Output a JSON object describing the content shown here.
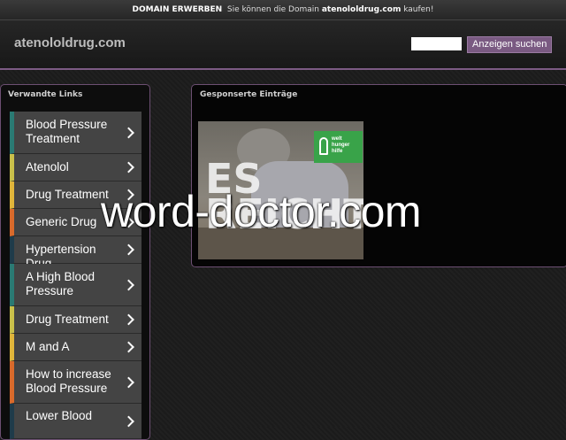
{
  "topbar": {
    "label": "DOMAIN ERWERBEN",
    "text_before": "Sie können die Domain",
    "domain": "atenololdrug.com",
    "text_after": "kaufen!"
  },
  "header": {
    "site_title": "atenololdrug.com",
    "search_placeholder": "",
    "search_button": "Anzeigen suchen"
  },
  "sidebar": {
    "title": "Verwandte Links",
    "items": [
      {
        "label": "Blood Pressure Treatment",
        "accent": "#2a7a73"
      },
      {
        "label": "Atenolol",
        "accent": "#c9c04a"
      },
      {
        "label": "Drug Treatment",
        "accent": "#e0b53a"
      },
      {
        "label": "Generic Drug",
        "accent": "#d96a2b"
      },
      {
        "label": "Hypertension Drug",
        "accent": "#1f3b4a"
      },
      {
        "label": "A High Blood Pressure",
        "accent": "#2a7a73"
      },
      {
        "label": "Drug Treatment",
        "accent": "#c9c04a"
      },
      {
        "label": "M and A",
        "accent": "#e0b53a"
      },
      {
        "label": "How to increase Blood Pressure",
        "accent": "#d96a2b"
      },
      {
        "label": "Lower Blood",
        "accent": "#1f3b4a"
      }
    ]
  },
  "main": {
    "title": "Gesponserte Einträge",
    "ad": {
      "headline": "ES\nREICHT!",
      "logo_text": "welt\nhunger\nhilfe"
    }
  },
  "watermark": "word-doctor.com",
  "colors": {
    "accent": "#7c5a84",
    "button": "#7a5a82"
  }
}
